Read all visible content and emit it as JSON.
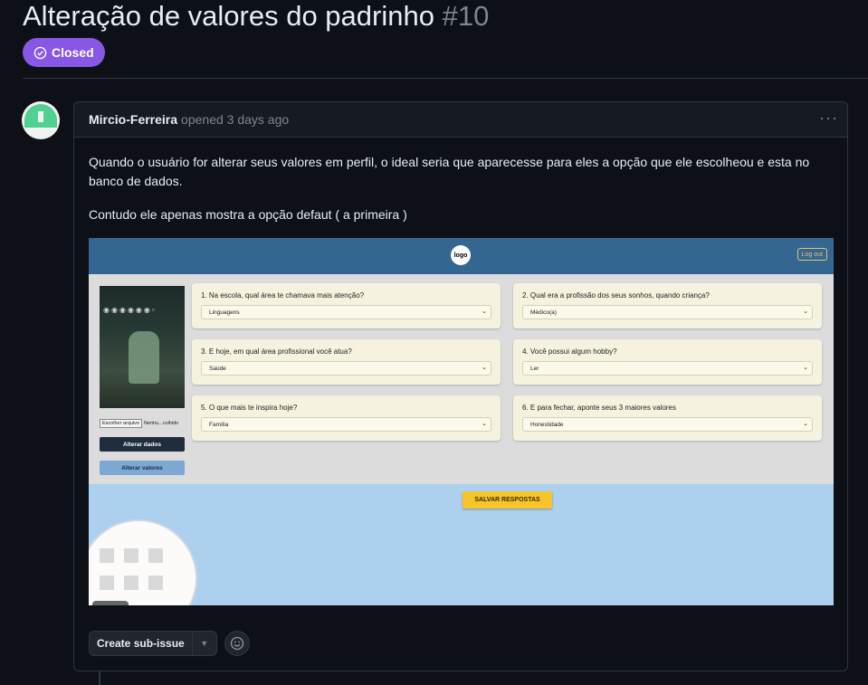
{
  "issue": {
    "title": "Alteração de valores do padrinho",
    "number": "#10",
    "state": "Closed",
    "state_color": "#8957e5"
  },
  "comment": {
    "author": "Mircio-Ferreira",
    "opened_text": "opened 3 days ago",
    "menu_icon": "kebab-horizontal-icon",
    "paragraphs": [
      "Quando o usuário for alterar seus valores em perfil, o ideal seria que aparecesse para eles a opção que ele escolheou e esta no banco de dados.",
      "Contudo ele apenas mostra a opção defaut ( a primeira )"
    ]
  },
  "screenshot": {
    "logo_text": "logo",
    "logout": "Log out",
    "file_button": "Escolher arquivo",
    "file_status": "Nenhu...colhido",
    "alter_data_button": "Alterar dados",
    "alter_values_button": "Alterar valores",
    "questions": [
      {
        "label": "1. Na escola, qual área te chamava mais atenção?",
        "value": "Linguagens"
      },
      {
        "label": "2. Qual era a profissão dos seus sonhos, quando criança?",
        "value": "Médico(a)"
      },
      {
        "label": "3. E hoje, em qual área profissional você atua?",
        "value": "Saúde"
      },
      {
        "label": "4. Você possui algum hobby?",
        "value": "Ler"
      },
      {
        "label": "5. O que mais te inspira hoje?",
        "value": "Família"
      },
      {
        "label": "6. E para fechar, aponte seus 3 maiores valores",
        "value": "Honestidade"
      }
    ],
    "save_button": "SALVAR RESPOSTAS",
    "colors": {
      "nav": "#336791",
      "save": "#f7c52a",
      "panel": "#dcdcdc",
      "background": "#add0ee"
    }
  },
  "actions": {
    "create_sub_issue": "Create sub-issue",
    "emoji_icon": "smiley-icon"
  }
}
